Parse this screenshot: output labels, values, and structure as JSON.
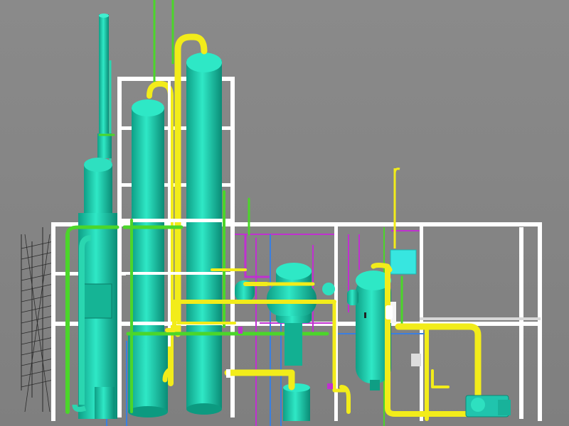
{
  "scene": {
    "description_kind": "3d-plant-model-viewport",
    "background_color": "#858585",
    "colors": {
      "vessel": "#20d6b4",
      "vessel_shade": "#0fa88c",
      "pipe_yellow": "#f2ec1a",
      "pipe_green": "#4bd62a",
      "pipe_magenta": "#c030d0",
      "pipe_blue": "#3a7fe0",
      "frame": "#ffffff",
      "box_cyan": "#37e6e0",
      "ladder": "#2a2a2a"
    },
    "equipment": [
      {
        "name": "stack-column",
        "type": "stack"
      },
      {
        "name": "column-left",
        "type": "column"
      },
      {
        "name": "column-middle",
        "type": "column"
      },
      {
        "name": "column-right",
        "type": "column"
      },
      {
        "name": "drum-center",
        "type": "drum"
      },
      {
        "name": "drum-right",
        "type": "drum"
      },
      {
        "name": "tank-bottom-center",
        "type": "tank"
      },
      {
        "name": "pump-right",
        "type": "pump"
      },
      {
        "name": "cyan-box",
        "type": "box"
      }
    ]
  }
}
